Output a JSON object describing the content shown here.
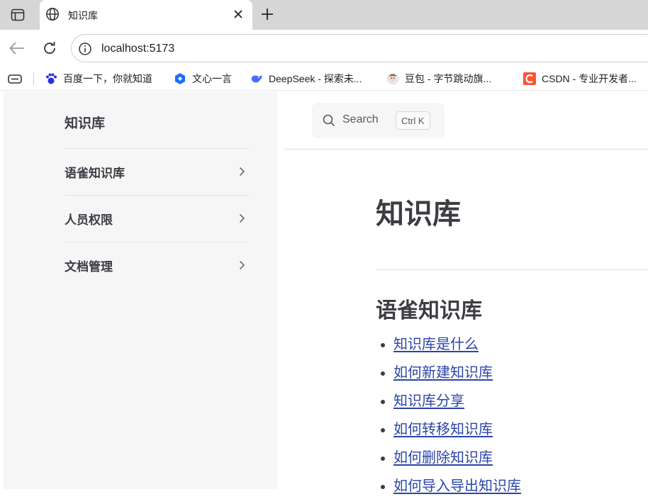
{
  "browser": {
    "tab": {
      "title": "知识库"
    },
    "address": {
      "url": "localhost:5173"
    },
    "bookmarks": [
      {
        "label": "百度一下，你就知道",
        "icon": "baidu-paw-icon"
      },
      {
        "label": "文心一言",
        "icon": "wenxin-icon"
      },
      {
        "label": "DeepSeek - 探索未...",
        "icon": "deepseek-whale-icon"
      },
      {
        "label": "豆包 - 字节跳动旗...",
        "icon": "doubao-avatar-icon"
      },
      {
        "label": "CSDN - 专业开发者...",
        "icon": "csdn-icon"
      }
    ]
  },
  "sidebar": {
    "title": "知识库",
    "items": [
      {
        "label": "语雀知识库"
      },
      {
        "label": "人员权限"
      },
      {
        "label": "文档管理"
      }
    ]
  },
  "search": {
    "placeholder": "Search",
    "shortcut_ctrl": "Ctrl",
    "shortcut_key": "K"
  },
  "doc": {
    "title": "知识库",
    "section_title": "语雀知识库",
    "links": [
      "知识库是什么",
      "如何新建知识库",
      "知识库分享",
      "如何转移知识库",
      "如何删除知识库",
      "如何导入导出知识库"
    ]
  },
  "colors": {
    "link": "#2b45a8",
    "sidebar_bg": "#f6f6f7",
    "tabstrip_bg": "#d6d6d6",
    "text": "#3c3c43"
  }
}
